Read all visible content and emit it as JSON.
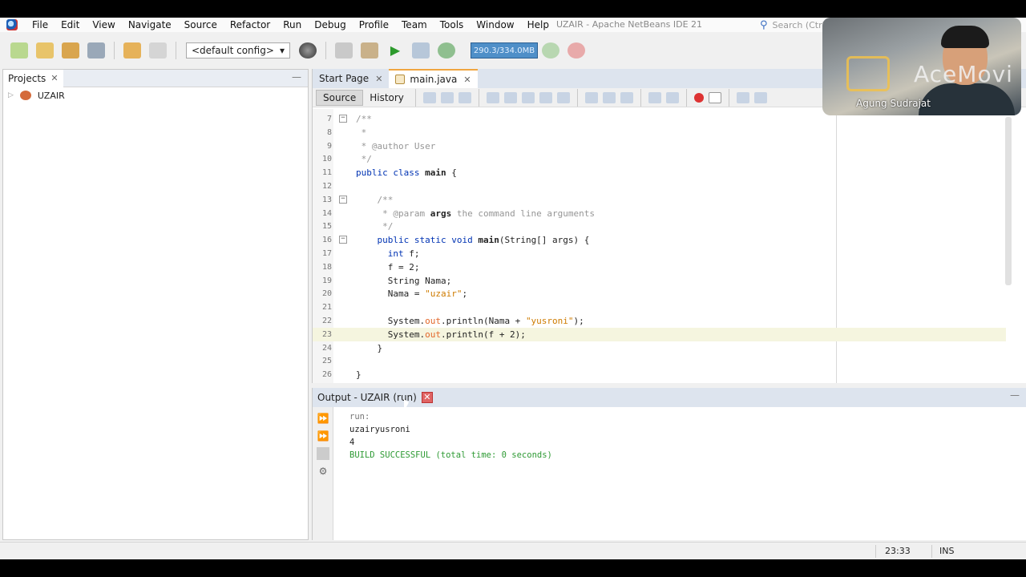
{
  "app": {
    "window_title": "UZAIR - Apache NetBeans IDE 21",
    "search_placeholder": "Search (Ctrl+I)"
  },
  "menu": [
    "File",
    "Edit",
    "View",
    "Navigate",
    "Source",
    "Refactor",
    "Run",
    "Debug",
    "Profile",
    "Team",
    "Tools",
    "Window",
    "Help"
  ],
  "toolbar": {
    "config_value": "<default config>",
    "memory_label": "290.3/334.0MB"
  },
  "projects": {
    "tab_label": "Projects",
    "tree": [
      {
        "label": "UZAIR"
      }
    ]
  },
  "editor": {
    "tabs": [
      {
        "label": "Start Page",
        "active": false
      },
      {
        "label": "main.java",
        "active": true
      }
    ],
    "modes": [
      "Source",
      "History"
    ],
    "lines": [
      {
        "n": "7",
        "tokens": [
          {
            "t": "/**",
            "c": "cm"
          }
        ],
        "fold": "−"
      },
      {
        "n": "8",
        "tokens": [
          {
            "t": " *",
            "c": "cm"
          }
        ]
      },
      {
        "n": "9",
        "tokens": [
          {
            "t": " * @author User",
            "c": "cm"
          }
        ]
      },
      {
        "n": "10",
        "tokens": [
          {
            "t": " */",
            "c": "cm"
          }
        ]
      },
      {
        "n": "11",
        "tokens": [
          {
            "t": "public class ",
            "c": "kw"
          },
          {
            "t": "main",
            "c": "bold"
          },
          {
            "t": " {",
            "c": ""
          }
        ]
      },
      {
        "n": "12",
        "tokens": []
      },
      {
        "n": "13",
        "tokens": [
          {
            "t": "    /**",
            "c": "cm"
          }
        ],
        "fold": "−"
      },
      {
        "n": "14",
        "tokens": [
          {
            "t": "     * @param ",
            "c": "cm"
          },
          {
            "t": "args",
            "c": "bold"
          },
          {
            "t": " the command line arguments",
            "c": "cm"
          }
        ]
      },
      {
        "n": "15",
        "tokens": [
          {
            "t": "     */",
            "c": "cm"
          }
        ]
      },
      {
        "n": "16",
        "tokens": [
          {
            "t": "    public static void ",
            "c": "kw"
          },
          {
            "t": "main",
            "c": "bold"
          },
          {
            "t": "(String[] args) {",
            "c": ""
          }
        ],
        "fold": "−"
      },
      {
        "n": "17",
        "tokens": [
          {
            "t": "      int ",
            "c": "kw"
          },
          {
            "t": "f;",
            "c": ""
          }
        ]
      },
      {
        "n": "18",
        "tokens": [
          {
            "t": "      f = 2;",
            "c": ""
          }
        ]
      },
      {
        "n": "19",
        "tokens": [
          {
            "t": "      String Nama;",
            "c": ""
          }
        ]
      },
      {
        "n": "20",
        "tokens": [
          {
            "t": "      Nama = ",
            "c": ""
          },
          {
            "t": "\"uzair\"",
            "c": "st"
          },
          {
            "t": ";",
            "c": ""
          }
        ]
      },
      {
        "n": "21",
        "tokens": []
      },
      {
        "n": "22",
        "tokens": [
          {
            "t": "      System.",
            "c": ""
          },
          {
            "t": "out",
            "c": "fld"
          },
          {
            "t": ".println(Nama + ",
            "c": ""
          },
          {
            "t": "\"yusroni\"",
            "c": "st"
          },
          {
            "t": ");",
            "c": ""
          }
        ]
      },
      {
        "n": "23",
        "tokens": [
          {
            "t": "      System.",
            "c": ""
          },
          {
            "t": "out",
            "c": "fld"
          },
          {
            "t": ".println(f + 2);",
            "c": ""
          }
        ],
        "current": true
      },
      {
        "n": "24",
        "tokens": [
          {
            "t": "    }",
            "c": ""
          }
        ]
      },
      {
        "n": "25",
        "tokens": []
      },
      {
        "n": "26",
        "tokens": [
          {
            "t": "}",
            "c": ""
          }
        ]
      }
    ]
  },
  "output": {
    "tab_label": "Output - UZAIR (run)",
    "lines": [
      {
        "text": "run:",
        "style": "out-muted"
      },
      {
        "text": "uzairyusroni",
        "style": ""
      },
      {
        "text": "4",
        "style": ""
      },
      {
        "text": "BUILD SUCCESSFUL (total time: 0 seconds)",
        "style": "out-success"
      }
    ]
  },
  "status": {
    "cursor_position": "23:33",
    "insert_mode": "INS"
  },
  "webcam": {
    "brand": "AceMovi",
    "presenter_name": "Agung Sudrajat"
  }
}
